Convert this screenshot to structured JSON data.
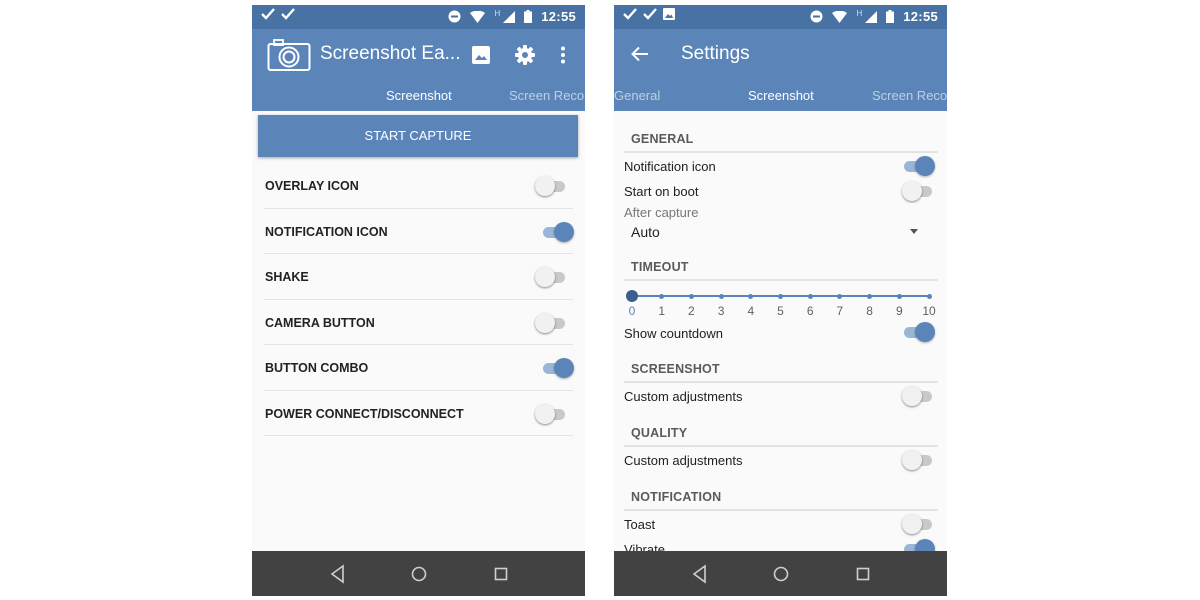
{
  "colors": {
    "primary": "#5b85b9",
    "primary_dark": "#4872a3",
    "nav_bar": "#424242",
    "switch_on": "#5b85b9",
    "switch_off": "#f1f1f1"
  },
  "status_bar": {
    "time": "12:55",
    "indicator": "H",
    "left_icons": [
      "check-icon",
      "check-icon"
    ],
    "right_icons": [
      "do-not-disturb-icon",
      "wifi-icon",
      "signal-icon",
      "battery-icon"
    ]
  },
  "left_screen": {
    "app_bar": {
      "title": "Screenshot Ea...",
      "logo_icon": "camera-icon",
      "actions": [
        "gallery-icon",
        "gear-icon",
        "more-vert-icon"
      ]
    },
    "tabs": [
      {
        "label": "Screenshot",
        "active": true
      },
      {
        "label": "Screen Reco",
        "active": false
      }
    ],
    "start_button": "START CAPTURE",
    "options": [
      {
        "label": "OVERLAY ICON",
        "on": false
      },
      {
        "label": "NOTIFICATION ICON",
        "on": true
      },
      {
        "label": "SHAKE",
        "on": false
      },
      {
        "label": "CAMERA BUTTON",
        "on": false
      },
      {
        "label": "BUTTON COMBO",
        "on": true
      },
      {
        "label": "POWER CONNECT/DISCONNECT",
        "on": false
      }
    ]
  },
  "right_screen": {
    "status_left_icons": [
      "check-icon",
      "check-icon",
      "image-icon"
    ],
    "app_bar": {
      "title": "Settings",
      "back_icon": "arrow-back-icon"
    },
    "tabs": [
      {
        "label": "General",
        "active": false
      },
      {
        "label": "Screenshot",
        "active": true
      },
      {
        "label": "Screen Reco",
        "active": false
      }
    ],
    "sections": {
      "general": {
        "header": "GENERAL",
        "notification_icon": {
          "label": "Notification icon",
          "on": true
        },
        "start_on_boot": {
          "label": "Start on boot",
          "on": false
        },
        "after_capture": {
          "label": "After capture",
          "value": "Auto"
        }
      },
      "timeout": {
        "header": "TIMEOUT",
        "ticks": [
          "0",
          "1",
          "2",
          "3",
          "4",
          "5",
          "6",
          "7",
          "8",
          "9",
          "10"
        ],
        "value": 0,
        "show_countdown": {
          "label": "Show countdown",
          "on": true
        }
      },
      "screenshot": {
        "header": "SCREENSHOT",
        "custom_adjustments": {
          "label": "Custom adjustments",
          "on": false
        }
      },
      "quality": {
        "header": "QUALITY",
        "custom_adjustments": {
          "label": "Custom adjustments",
          "on": false
        }
      },
      "notification": {
        "header": "NOTIFICATION",
        "toast": {
          "label": "Toast",
          "on": false
        },
        "vibrate": {
          "label": "Vibrate",
          "on": true
        }
      }
    }
  },
  "nav_bar": {
    "buttons": [
      "back-triangle-icon",
      "home-circle-icon",
      "recents-square-icon"
    ]
  }
}
